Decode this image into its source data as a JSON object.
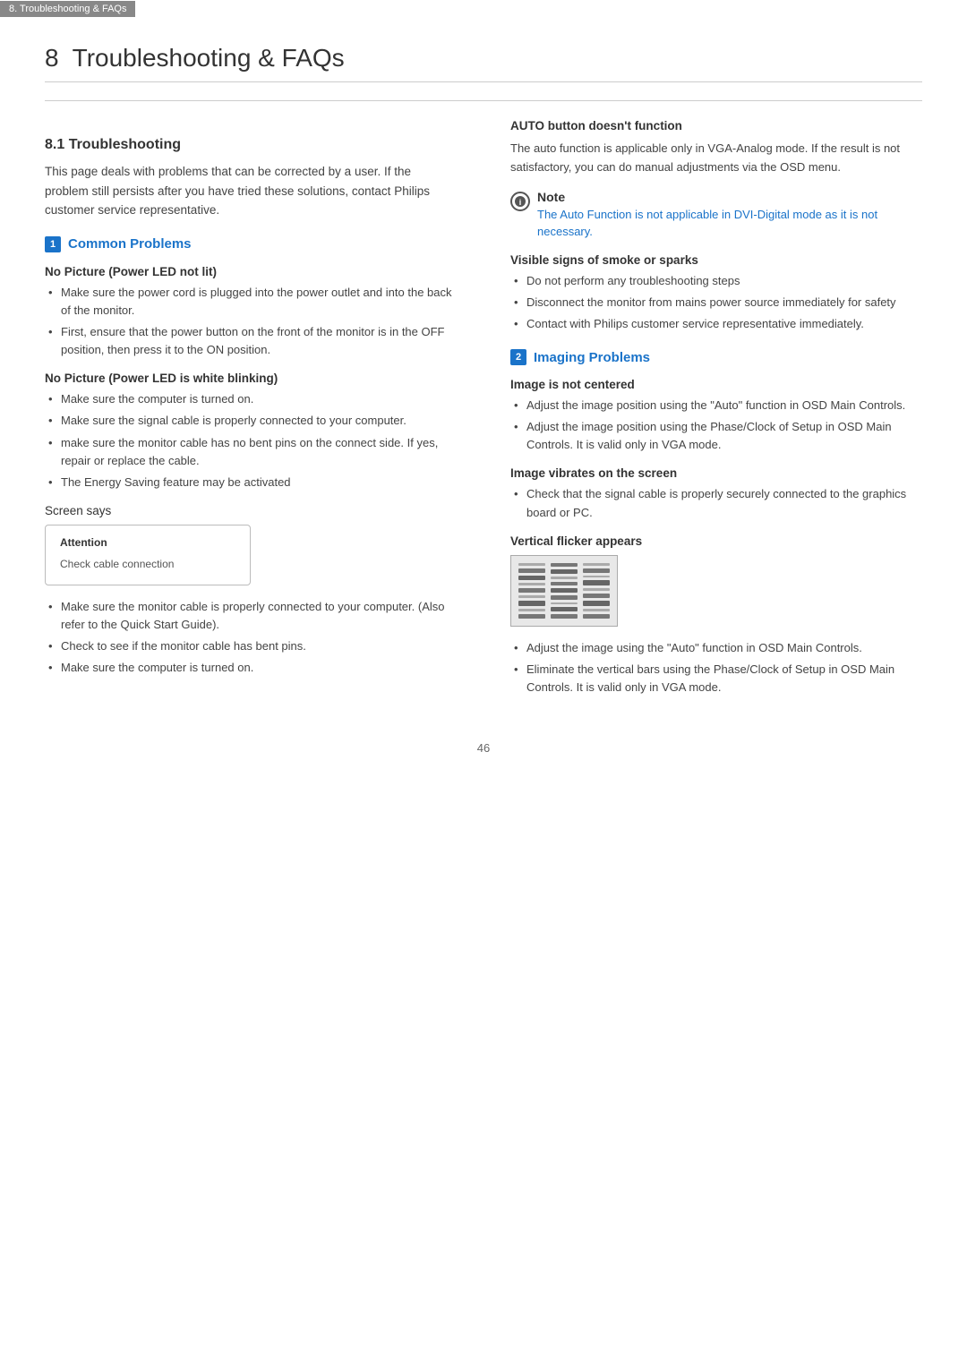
{
  "topbar": {
    "label": "8. Troubleshooting & FAQs"
  },
  "chapter": {
    "number": "8",
    "title": "Troubleshooting & FAQs"
  },
  "section81": {
    "heading": "8.1 Troubleshooting",
    "intro": "This page deals with problems that can be corrected by a user. If the problem still persists after you have tried these solutions, contact Philips customer service representative."
  },
  "commonProblems": {
    "badge": "1",
    "title": "Common Problems",
    "noPictureLED": {
      "heading": "No Picture (Power LED not lit)",
      "bullets": [
        "Make sure the power cord is plugged into the power outlet and into the back of the monitor.",
        "First, ensure that the power button on the front of the monitor is in the OFF position, then press it to the ON position."
      ]
    },
    "noPictureWhite": {
      "heading": "No Picture (Power LED is white blinking)",
      "bullets": [
        "Make sure the computer is turned on.",
        "Make sure the signal cable is properly connected to your computer.",
        "make sure the monitor cable has no bent pins on the connect side. If yes, repair or replace the cable.",
        "The Energy Saving feature may be activated"
      ]
    },
    "screenSays": {
      "label": "Screen says",
      "attentionTitle": "Attention",
      "attentionBody": "Check cable connection"
    },
    "screenBullets": [
      "Make sure the monitor cable is properly connected to your computer. (Also refer to the Quick Start Guide).",
      "Check to see if the monitor cable has bent pins.",
      "Make sure the computer is turned on."
    ],
    "autoButton": {
      "heading": "AUTO button doesn't function",
      "text": "The auto function is applicable only in VGA-Analog mode. If the result is not satisfactory, you can do manual adjustments via the OSD menu."
    },
    "note": {
      "label": "Note",
      "text": "The Auto Function is not applicable in DVI-Digital mode as it is not necessary."
    },
    "visibleSigns": {
      "heading": "Visible signs of smoke or sparks",
      "bullets": [
        "Do not perform any troubleshooting steps",
        "Disconnect the monitor from mains power source immediately for safety",
        "Contact with Philips customer service representative immediately."
      ]
    }
  },
  "imagingProblems": {
    "badge": "2",
    "title": "Imaging Problems",
    "imageCentered": {
      "heading": "Image is not centered",
      "bullets": [
        "Adjust the image position using the \"Auto\" function in OSD Main Controls.",
        "Adjust the image position using the Phase/Clock of Setup in OSD Main Controls. It is valid only in VGA mode."
      ]
    },
    "imageVibrates": {
      "heading": "Image vibrates on the screen",
      "bullets": [
        "Check that the signal cable is properly securely connected to the graphics board or PC."
      ]
    },
    "verticalFlicker": {
      "heading": "Vertical flicker appears",
      "bullets": [
        "Adjust the image using the \"Auto\" function in OSD Main Controls.",
        "Eliminate the vertical bars using the Phase/Clock of Setup in OSD Main Controls. It is valid only in VGA mode."
      ]
    }
  },
  "pageNumber": "46"
}
